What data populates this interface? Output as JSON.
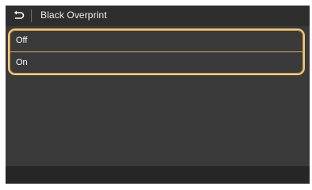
{
  "header": {
    "title": "Black Overprint"
  },
  "options": [
    {
      "label": "Off"
    },
    {
      "label": "On"
    }
  ],
  "colors": {
    "highlight": "#f0c97a",
    "background": "#3a3a3a",
    "header": "#2e2e2e"
  },
  "icons": {
    "back": "back-arrow-icon"
  }
}
